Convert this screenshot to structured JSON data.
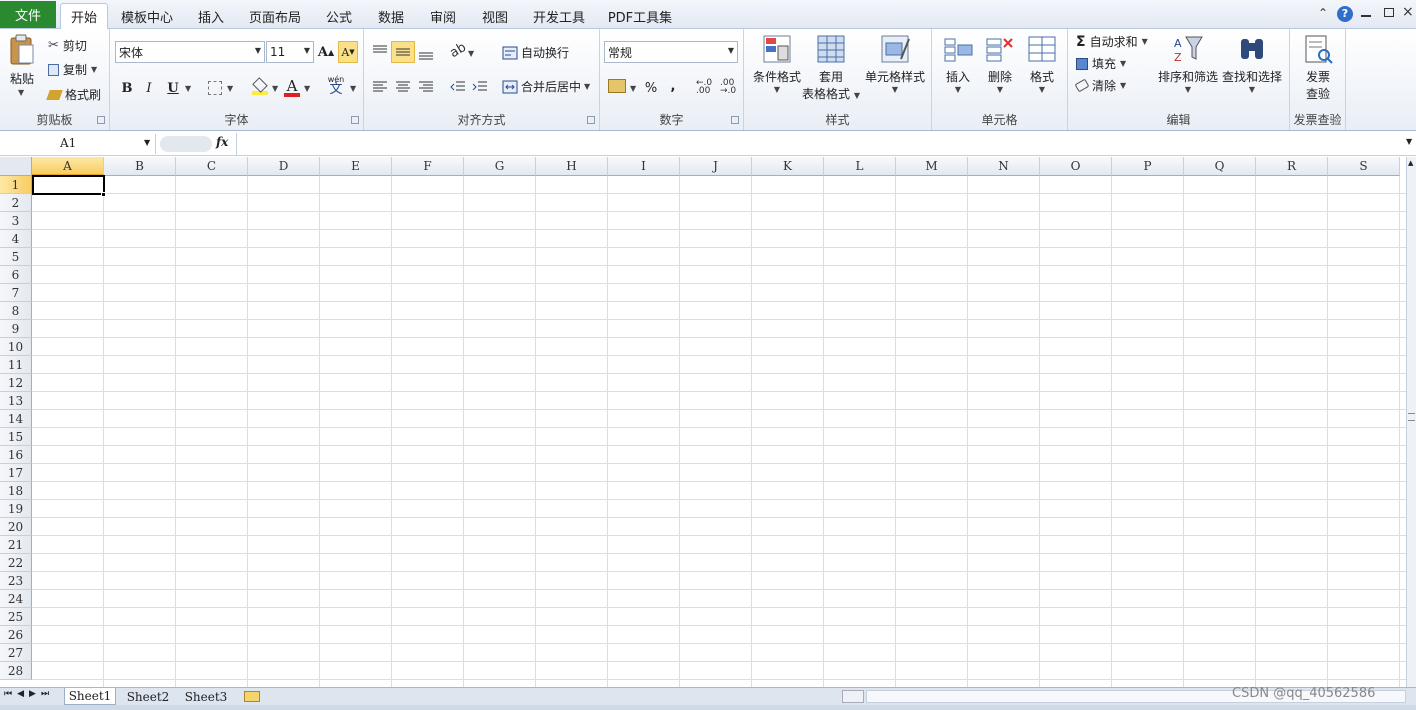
{
  "tabs": {
    "file": "文件",
    "items": [
      "开始",
      "模板中心",
      "插入",
      "页面布局",
      "公式",
      "数据",
      "审阅",
      "视图",
      "开发工具",
      "PDF工具集"
    ]
  },
  "clipboard": {
    "paste": "粘贴",
    "cut": "剪切",
    "copy": "复制",
    "format_painter": "格式刷",
    "label": "剪贴板"
  },
  "font": {
    "name": "宋体",
    "size": "11",
    "bold": "B",
    "italic": "I",
    "underline": "U",
    "label": "字体",
    "wen": "wén",
    "wen2": "文"
  },
  "alignment": {
    "wrap": "自动换行",
    "merge": "合并后居中",
    "label": "对齐方式"
  },
  "number": {
    "format": "常规",
    "percent": "%",
    "comma": ",",
    "label": "数字"
  },
  "styles": {
    "conditional": "条件格式",
    "table1": "套用",
    "table2": "表格格式",
    "cell_styles": "单元格样式",
    "label": "样式"
  },
  "cells": {
    "insert": "插入",
    "delete": "删除",
    "format": "格式",
    "label": "单元格"
  },
  "editing": {
    "autosum": "自动求和",
    "fill": "填充",
    "clear": "清除",
    "sort": "排序和筛选",
    "find": "查找和选择",
    "label": "编辑"
  },
  "invoice": {
    "line1": "发票",
    "line2": "查验",
    "label": "发票查验"
  },
  "formula_bar": {
    "name_box": "A1",
    "fx": "fx",
    "value": ""
  },
  "columns": [
    "A",
    "B",
    "C",
    "D",
    "E",
    "F",
    "G",
    "H",
    "I",
    "J",
    "K",
    "L",
    "M",
    "N",
    "O",
    "P",
    "Q",
    "R",
    "S"
  ],
  "rows": [
    "1",
    "2",
    "3",
    "4",
    "5",
    "6",
    "7",
    "8",
    "9",
    "10",
    "11",
    "12",
    "13",
    "14",
    "15",
    "16",
    "17",
    "18",
    "19",
    "20",
    "21",
    "22",
    "23",
    "24",
    "25",
    "26",
    "27",
    "28"
  ],
  "sheets": [
    "Sheet1",
    "Sheet2",
    "Sheet3"
  ],
  "watermark": "CSDN @qq_40562586"
}
